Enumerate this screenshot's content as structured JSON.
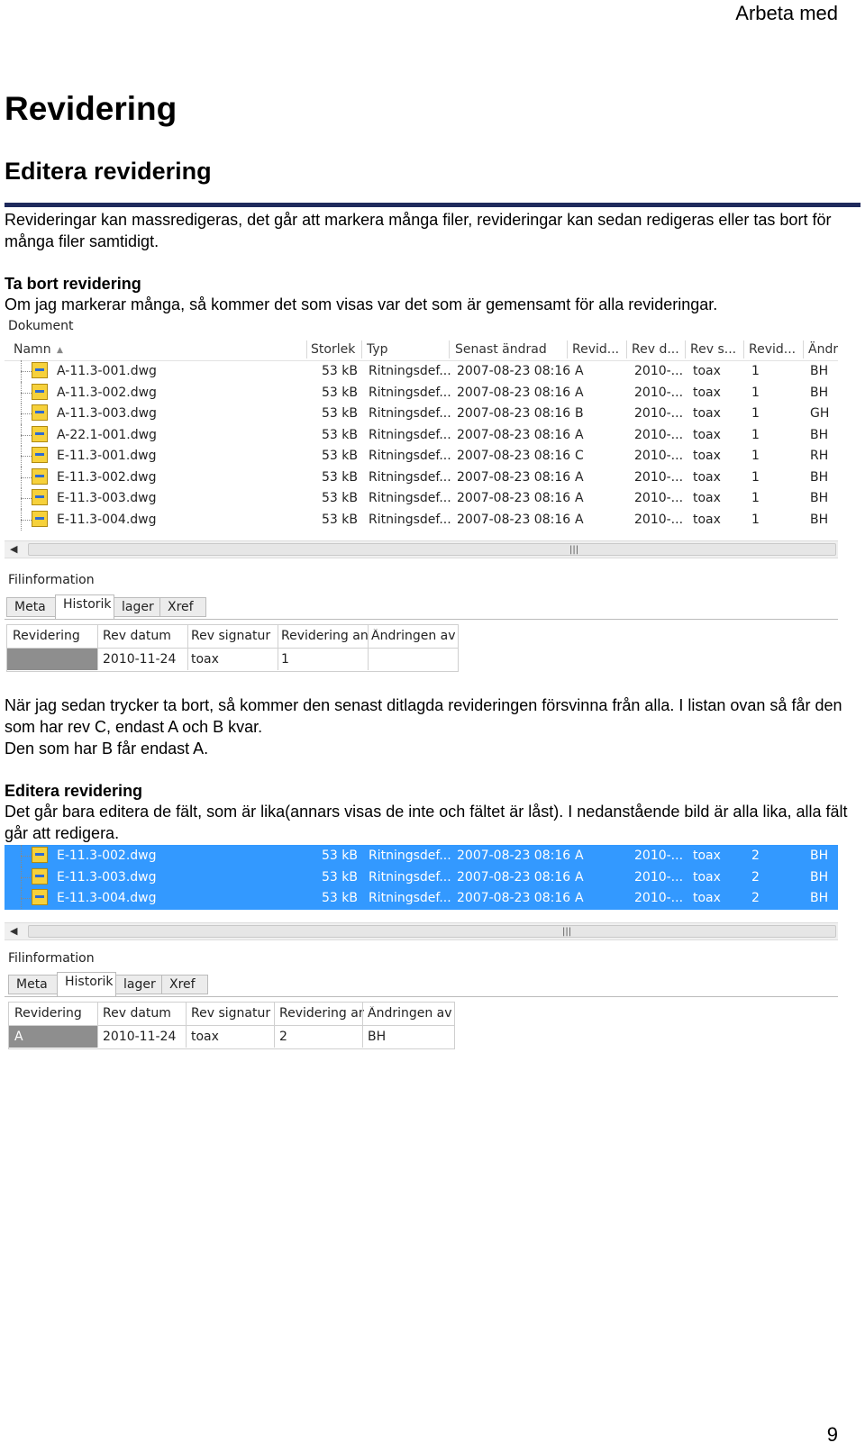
{
  "header": {
    "right": "Arbeta med"
  },
  "title": "Revidering",
  "subtitle": "Editera revidering",
  "intro": "Revideringar kan massredigeras, det går att markera många filer, revideringar kan sedan redigeras eller tas bort för många filer samtidigt.",
  "section1": {
    "heading": "Ta bort revidering",
    "text": "Om jag markerar många, så kommer det som visas var det som är gemensamt för alla revideringar."
  },
  "panel1": {
    "title": "Dokument",
    "columns": [
      "Namn",
      "Storlek",
      "Typ",
      "Senast ändrad",
      "Revid...",
      "Rev d...",
      "Rev s...",
      "Revid...",
      "Ändri"
    ],
    "rows": [
      [
        "A-11.3-001.dwg",
        "53 kB",
        "Ritningsdef...",
        "2007-08-23 08:16",
        "A",
        "2010-...",
        "toax",
        "1",
        "BH"
      ],
      [
        "A-11.3-002.dwg",
        "53 kB",
        "Ritningsdef...",
        "2007-08-23 08:16",
        "A",
        "2010-...",
        "toax",
        "1",
        "BH"
      ],
      [
        "A-11.3-003.dwg",
        "53 kB",
        "Ritningsdef...",
        "2007-08-23 08:16",
        "B",
        "2010-...",
        "toax",
        "1",
        "GH"
      ],
      [
        "A-22.1-001.dwg",
        "53 kB",
        "Ritningsdef...",
        "2007-08-23 08:16",
        "A",
        "2010-...",
        "toax",
        "1",
        "BH"
      ],
      [
        "E-11.3-001.dwg",
        "53 kB",
        "Ritningsdef...",
        "2007-08-23 08:16",
        "C",
        "2010-...",
        "toax",
        "1",
        "RH"
      ],
      [
        "E-11.3-002.dwg",
        "53 kB",
        "Ritningsdef...",
        "2007-08-23 08:16",
        "A",
        "2010-...",
        "toax",
        "1",
        "BH"
      ],
      [
        "E-11.3-003.dwg",
        "53 kB",
        "Ritningsdef...",
        "2007-08-23 08:16",
        "A",
        "2010-...",
        "toax",
        "1",
        "BH"
      ],
      [
        "E-11.3-004.dwg",
        "53 kB",
        "Ritningsdef...",
        "2007-08-23 08:16",
        "A",
        "2010-...",
        "toax",
        "1",
        "BH"
      ]
    ]
  },
  "fileinfo1": {
    "title": "Filinformation",
    "tabs": [
      "Meta",
      "Historik",
      "lager",
      "Xref"
    ],
    "columns": [
      "Revidering",
      "Rev datum",
      "Rev signatur",
      "Revidering anta",
      "Ändringen avse"
    ],
    "row": [
      "",
      "2010-11-24",
      "toax",
      "1",
      ""
    ]
  },
  "para2": [
    "När jag sedan trycker ta bort, så kommer den senast ditlagda revideringen försvinna från alla. I listan ovan så får den som har rev C, endast A och B kvar.",
    "Den som har B får endast A."
  ],
  "section2": {
    "heading": "Editera revidering",
    "text": "Det går bara editera de fält, som är lika(annars visas de inte och fältet är låst). I nedanstående bild är alla lika, alla fält går att redigera."
  },
  "panel2": {
    "rows": [
      [
        "E-11.3-002.dwg",
        "53 kB",
        "Ritningsdef...",
        "2007-08-23 08:16",
        "A",
        "2010-...",
        "toax",
        "2",
        "BH"
      ],
      [
        "E-11.3-003.dwg",
        "53 kB",
        "Ritningsdef...",
        "2007-08-23 08:16",
        "A",
        "2010-...",
        "toax",
        "2",
        "BH"
      ],
      [
        "E-11.3-004.dwg",
        "53 kB",
        "Ritningsdef...",
        "2007-08-23 08:16",
        "A",
        "2010-...",
        "toax",
        "2",
        "BH"
      ]
    ]
  },
  "fileinfo2": {
    "title": "Filinformation",
    "tabs": [
      "Meta",
      "Historik",
      "lager",
      "Xref"
    ],
    "columns": [
      "Revidering",
      "Rev datum",
      "Rev signatur",
      "Revidering anta",
      "Ändringen avse"
    ],
    "row": [
      "A",
      "2010-11-24",
      "toax",
      "2",
      "BH"
    ]
  },
  "page_number": "9",
  "colors": {
    "rule": "#1f2a5c",
    "selection": "#3399ff",
    "icon": "#f6d13b"
  }
}
